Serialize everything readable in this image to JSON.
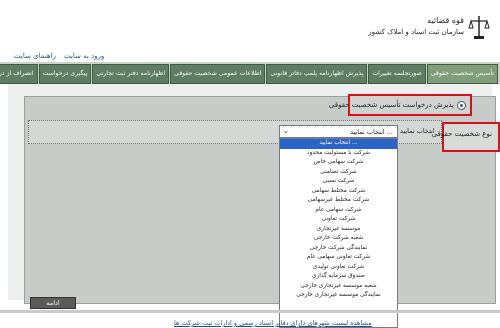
{
  "header": {
    "logo_line1": "قوه قضائیه",
    "logo_line2": "سازمان ثبت اسناد و املاک کشور",
    "links": [
      "ورود به سایت",
      "راهنمای سایت"
    ]
  },
  "nav": {
    "tabs": [
      "تأسیس شخصیت حقوقی",
      "صورتجلسه تغییرات",
      "پذیرش اظهارنامه پلمپ دفاتر قانونی",
      "اطلاعات عمومی شخصیت حقوقی",
      "اظهارنامه دفتر ثبت تجارتی",
      "پیگیری درخواست",
      "انصراف از درخواست"
    ],
    "active_index": 0
  },
  "form": {
    "radio_label": "پذیرش درخواست تأسیس شخصیت حقوقی",
    "type_label": "نوع شخصیت حقوقی",
    "select_label": "انتخاب نمایید",
    "select_value": "انتخاب نمایید ...",
    "options": [
      "انتخاب نمایید ...",
      "شرکت با مسئولیت محدود",
      "شرکت سهامی خاص",
      "شرکت تضامنی",
      "شرکت نسبی",
      "شرکت مختلط سهامی",
      "شرکت مختلط غیرسهامی",
      "شرکت سهامی عام",
      "شرکت تعاونی",
      "موسسه غیرتجاری",
      "شعبه شرکت خارجی",
      "نمایندگی شرکت خارجی",
      "شرکت تعاونی سهامی عام",
      "شرکت تعاونی تولیدی",
      "صندوق سرمایه گذاری",
      "شعبه موسسه غیرتجاری خارجی",
      "نمایندگی موسسه غیرتجاری خارجی"
    ],
    "selected_index": 0,
    "continue_label": "ادامه"
  },
  "footer": {
    "link_text": "مشاهده لیست شهرهای دارای دفاتر اسناد رسمی و ادارات ثبت شرکت ها"
  },
  "colors": {
    "nav_bg": "#5e7d63",
    "highlight_border": "#d8101b",
    "selected_option": "#2a64c8"
  }
}
